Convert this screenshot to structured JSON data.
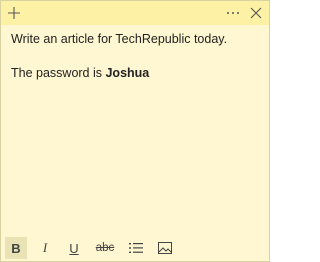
{
  "titlebar": {
    "add_icon": "plus-icon",
    "more_icon": "ellipsis-icon",
    "close_icon": "close-icon"
  },
  "note": {
    "line1": "Write an article for TechRepublic today.",
    "line2_prefix": "The password is ",
    "line2_bold": "Joshua"
  },
  "toolbar": {
    "bold_label": "B",
    "italic_label": "I",
    "underline_label": "U",
    "strike_label": "abc",
    "list_icon": "bulleted-list-icon",
    "image_icon": "image-icon"
  },
  "colors": {
    "note_background": "#fff7d1",
    "titlebar_background": "#fdf1a6",
    "active_tool_background": "#e9e2b4"
  }
}
